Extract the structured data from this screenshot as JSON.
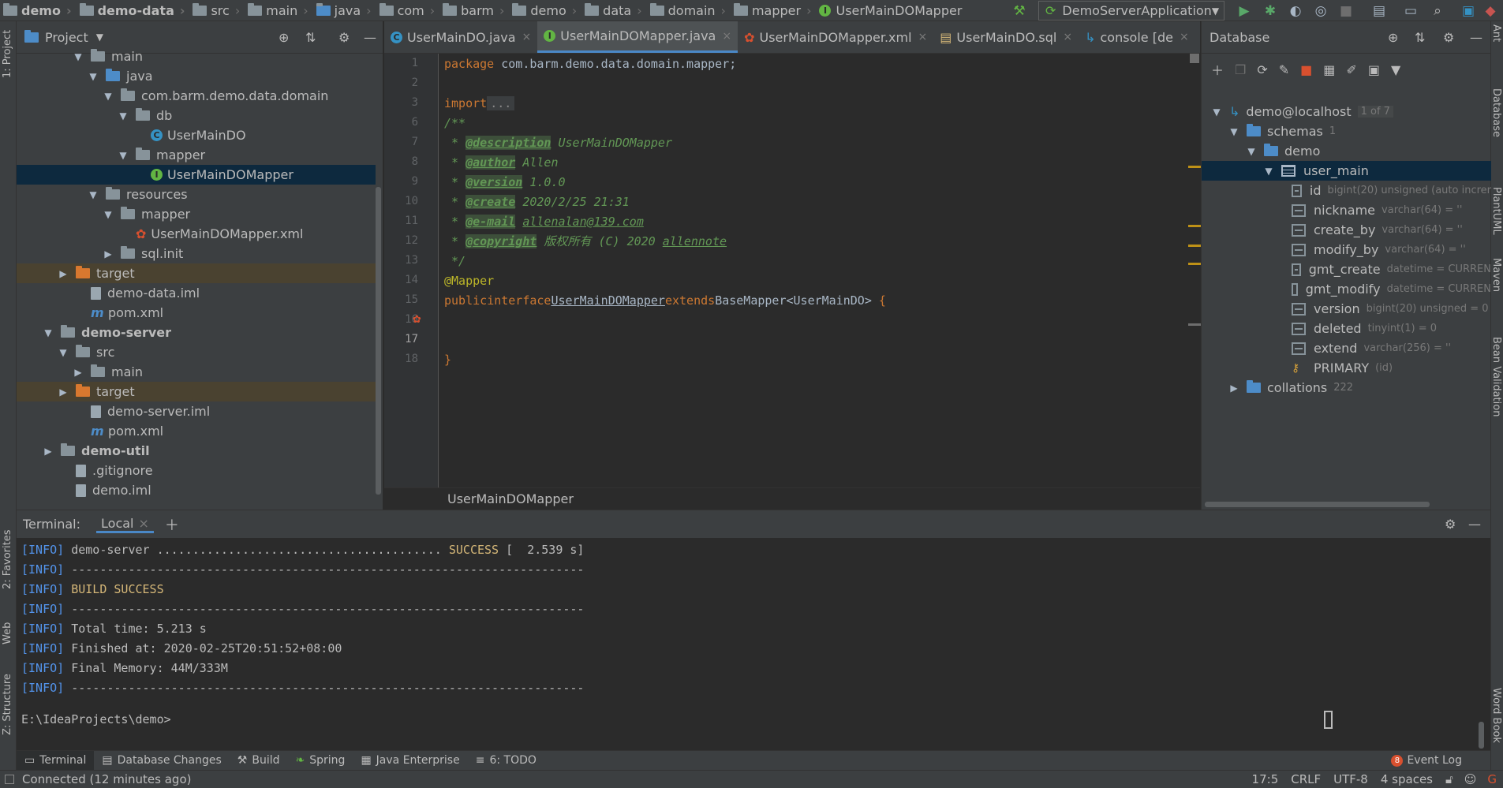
{
  "nav": {
    "crumbs": [
      "demo",
      "demo-data",
      "src",
      "main",
      "java",
      "com",
      "barm",
      "demo",
      "data",
      "domain",
      "mapper"
    ],
    "current": "UserMainDOMapper",
    "run_config": "DemoServerApplication"
  },
  "side": {
    "project": "1: Project",
    "favorites": "2: Favorites",
    "web": "Web",
    "structure": "Z: Structure",
    "right": [
      "Ant",
      "Database",
      "PlantUML",
      "Maven",
      "Bean Validation",
      "Word Book"
    ]
  },
  "project": {
    "title": "Project",
    "rows": [
      {
        "label": "main",
        "level": 3,
        "arrow": "▼",
        "icon": "folder"
      },
      {
        "label": "java",
        "level": 4,
        "arrow": "▼",
        "icon": "folder-blue"
      },
      {
        "label": "com.barm.demo.data.domain",
        "level": 5,
        "arrow": "▼",
        "icon": "folder"
      },
      {
        "label": "db",
        "level": 6,
        "arrow": "▼",
        "icon": "folder"
      },
      {
        "label": "UserMainDO",
        "level": 7,
        "arrow": "",
        "icon": "class"
      },
      {
        "label": "mapper",
        "level": 6,
        "arrow": "▼",
        "icon": "folder"
      },
      {
        "label": "UserMainDOMapper",
        "level": 7,
        "arrow": "",
        "icon": "interface",
        "selected": true
      },
      {
        "label": "resources",
        "level": 4,
        "arrow": "▼",
        "icon": "folder-res"
      },
      {
        "label": "mapper",
        "level": 5,
        "arrow": "▼",
        "icon": "folder"
      },
      {
        "label": "UserMainDOMapper.xml",
        "level": 6,
        "arrow": "",
        "icon": "xml"
      },
      {
        "label": "sql.init",
        "level": 5,
        "arrow": "▶",
        "icon": "folder"
      },
      {
        "label": "target",
        "level": 2,
        "arrow": "▶",
        "icon": "folder-orange",
        "excluded": true
      },
      {
        "label": "demo-data.iml",
        "level": 3,
        "arrow": "",
        "icon": "file"
      },
      {
        "label": "pom.xml",
        "level": 3,
        "arrow": "",
        "icon": "maven"
      },
      {
        "label": "demo-server",
        "level": 1,
        "arrow": "▼",
        "icon": "folder",
        "bold": true
      },
      {
        "label": "src",
        "level": 2,
        "arrow": "▼",
        "icon": "folder"
      },
      {
        "label": "main",
        "level": 3,
        "arrow": "▶",
        "icon": "folder"
      },
      {
        "label": "target",
        "level": 2,
        "arrow": "▶",
        "icon": "folder-orange",
        "excluded": true
      },
      {
        "label": "demo-server.iml",
        "level": 3,
        "arrow": "",
        "icon": "file"
      },
      {
        "label": "pom.xml",
        "level": 3,
        "arrow": "",
        "icon": "maven"
      },
      {
        "label": "demo-util",
        "level": 1,
        "arrow": "▶",
        "icon": "folder",
        "bold": true
      },
      {
        "label": ".gitignore",
        "level": 2,
        "arrow": "",
        "icon": "file"
      },
      {
        "label": "demo.iml",
        "level": 2,
        "arrow": "",
        "icon": "file"
      }
    ]
  },
  "editor": {
    "tabs": [
      {
        "label": "UserMainDO.java",
        "icon": "class"
      },
      {
        "label": "UserMainDOMapper.java",
        "icon": "interface",
        "active": true
      },
      {
        "label": "UserMainDOMapper.xml",
        "icon": "xml"
      },
      {
        "label": "UserMainDO.sql",
        "icon": "sql"
      },
      {
        "label": "console [de",
        "icon": "console"
      }
    ],
    "tab_overflow": "▾≡1",
    "line_numbers": [
      "1",
      "2",
      "3",
      "6",
      "7",
      "8",
      "9",
      "10",
      "11",
      "12",
      "13",
      "14",
      "15",
      "16",
      "17",
      "18"
    ],
    "code": {
      "package_kw": "package",
      "package_name": " com.barm.demo.data.domain.mapper;",
      "import_kw": "import",
      "import_fold": "...",
      "doc_open": "/**",
      "desc_tag": "@description",
      "desc_val": " UserMainDOMapper",
      "author_tag": "@author",
      "author_val": " Allen",
      "version_tag": "@version",
      "version_val": " 1.0.0",
      "create_tag": "@create",
      "create_val": " 2020/2/25 21:31",
      "email_tag": "@e-mail",
      "email_val": "allenalan@139.com",
      "copyright_tag": "@copyright",
      "copyright_val": " 版权所有 (C) 2020 ",
      "copyright_link": "allennote",
      "doc_close": " */",
      "annotation": "@Mapper",
      "public_kw": "public",
      "interface_kw": "interface",
      "class_name": "UserMainDOMapper",
      "extends_kw": "extends",
      "base_type": "BaseMapper<UserMainDO>",
      "open_brace": " {",
      "close_brace": "}"
    },
    "breadcrumb": "UserMainDOMapper"
  },
  "database": {
    "title": "Database",
    "root": "demo@localhost",
    "root_count": "1 of 7",
    "schemas": "schemas",
    "schemas_count": "1",
    "schema": "demo",
    "table": "user_main",
    "columns": [
      {
        "name": "id",
        "type": "bigint(20) unsigned (auto increr",
        "key": true
      },
      {
        "name": "nickname",
        "type": "varchar(64) = ''"
      },
      {
        "name": "create_by",
        "type": "varchar(64) = ''"
      },
      {
        "name": "modify_by",
        "type": "varchar(64) = ''"
      },
      {
        "name": "gmt_create",
        "type": "datetime = CURREN"
      },
      {
        "name": "gmt_modify",
        "type": "datetime = CURREN"
      },
      {
        "name": "version",
        "type": "bigint(20) unsigned = 0"
      },
      {
        "name": "deleted",
        "type": "tinyint(1) = 0"
      },
      {
        "name": "extend",
        "type": "varchar(256) = ''"
      }
    ],
    "index_name": "PRIMARY",
    "index_cols": "(id)",
    "collations": "collations",
    "collations_count": "222"
  },
  "terminal": {
    "title": "Terminal:",
    "tab": "Local",
    "lines": [
      {
        "prefix": "[INFO]",
        "text": " demo-server ........................................ ",
        "status": "SUCCESS",
        "rest": " [  2.539 s]"
      },
      {
        "prefix": "[INFO]",
        "text": " ------------------------------------------------------------------------",
        "status": "",
        "rest": ""
      },
      {
        "prefix": "[INFO]",
        "text": " ",
        "status": "BUILD SUCCESS",
        "rest": ""
      },
      {
        "prefix": "[INFO]",
        "text": " ------------------------------------------------------------------------",
        "status": "",
        "rest": ""
      },
      {
        "prefix": "[INFO]",
        "text": " Total time: 5.213 s",
        "status": "",
        "rest": ""
      },
      {
        "prefix": "[INFO]",
        "text": " Finished at: 2020-02-25T20:51:52+08:00",
        "status": "",
        "rest": ""
      },
      {
        "prefix": "[INFO]",
        "text": " Final Memory: 44M/333M",
        "status": "",
        "rest": ""
      },
      {
        "prefix": "[INFO]",
        "text": " ------------------------------------------------------------------------",
        "status": "",
        "rest": ""
      }
    ],
    "prompt": "E:\\IdeaProjects\\demo>"
  },
  "bottom_tabs": [
    "Terminal",
    "Database Changes",
    "Build",
    "Spring",
    "Java Enterprise",
    "6: TODO"
  ],
  "event_log": {
    "count": "8",
    "label": "Event Log"
  },
  "status": {
    "message": "Connected (12 minutes ago)",
    "position": "17:5",
    "line_sep": "CRLF",
    "encoding": "UTF-8",
    "indent": "4 spaces"
  },
  "colors": {
    "accent": "#4a88c7",
    "selected_bg": "#0d293e",
    "success": "#d5b778",
    "info": "#5394ec"
  }
}
